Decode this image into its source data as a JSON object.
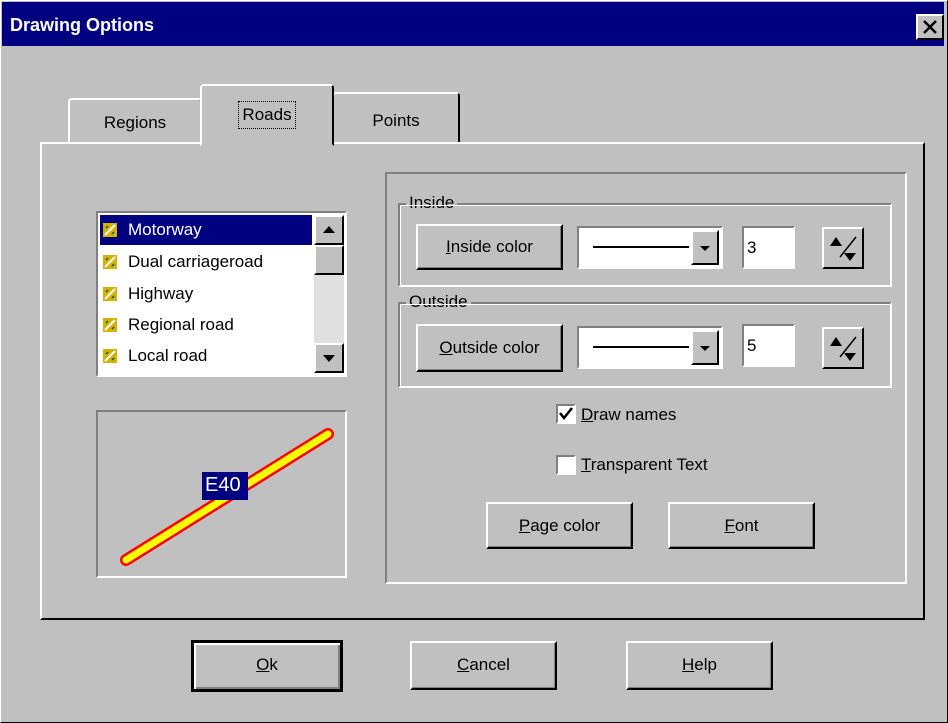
{
  "window": {
    "title": "Drawing Options"
  },
  "tabs": [
    {
      "label": "Regions",
      "active": false
    },
    {
      "label": "Roads",
      "active": true
    },
    {
      "label": "Points",
      "active": false
    }
  ],
  "road_types": [
    {
      "label": "Motorway",
      "selected": true,
      "icon": "road-icon"
    },
    {
      "label": "Dual carriageroad",
      "selected": false,
      "icon": "road-icon"
    },
    {
      "label": "Highway",
      "selected": false,
      "icon": "road-icon"
    },
    {
      "label": "Regional road",
      "selected": false,
      "icon": "road-icon"
    },
    {
      "label": "Local road",
      "selected": false,
      "icon": "road-icon"
    }
  ],
  "preview": {
    "road_label": "E40",
    "road_fill": "#ffff00",
    "road_outline": "#ff0000",
    "label_bg": "#000080"
  },
  "inside": {
    "group_label": "Inside",
    "button_prefix": "I",
    "button_rest": "nside color",
    "width_value": "3"
  },
  "outside": {
    "group_label": "Outside",
    "button_prefix": "O",
    "button_rest": "utside color",
    "width_value": "5"
  },
  "options": {
    "draw_names": {
      "prefix": "D",
      "rest": "raw names",
      "checked": true
    },
    "transparent_text": {
      "prefix": "T",
      "rest": "ransparent Text",
      "checked": false
    }
  },
  "buttons": {
    "page_color": {
      "prefix": "P",
      "rest": "age color"
    },
    "font": {
      "prefix": "F",
      "rest": "ont"
    },
    "ok": {
      "prefix": "O",
      "rest": "k"
    },
    "cancel": {
      "prefix": "C",
      "rest": "ancel"
    },
    "help": {
      "prefix": "H",
      "rest": "elp"
    }
  },
  "colors": {
    "titlebar": "#000080",
    "face": "#c0c0c0",
    "selection": "#000080"
  }
}
